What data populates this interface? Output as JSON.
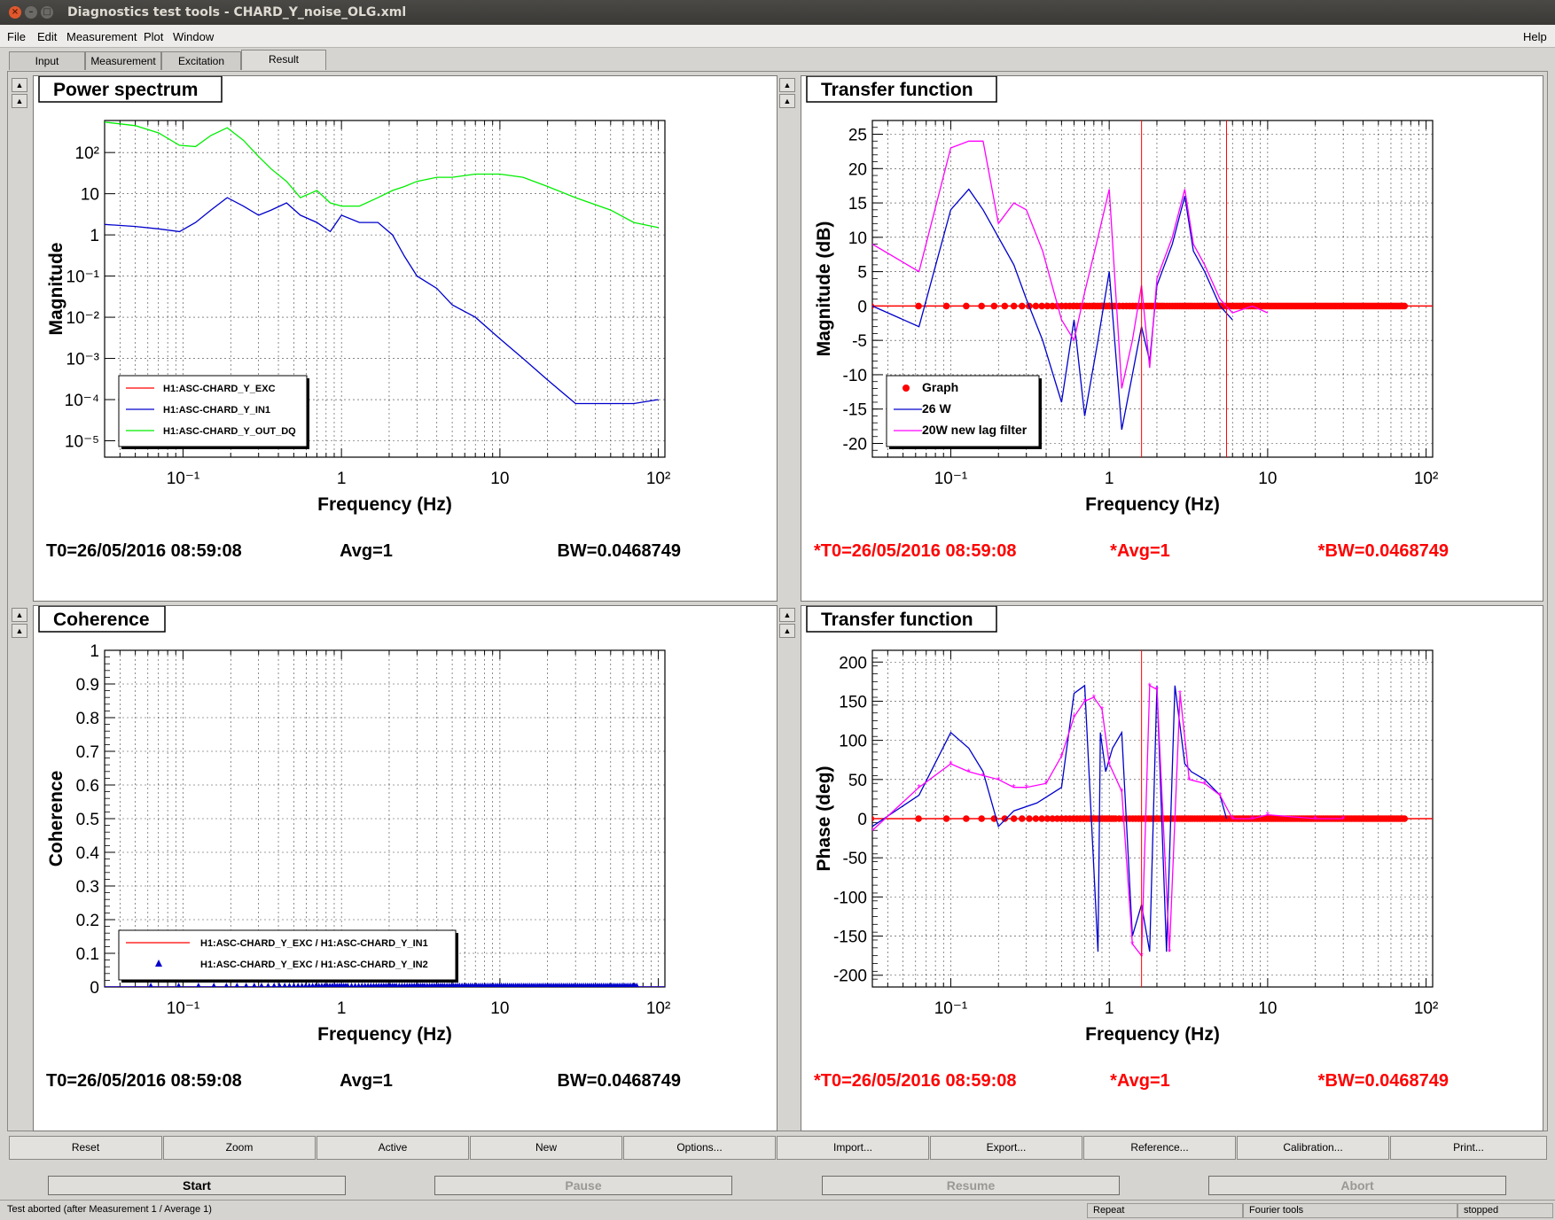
{
  "window": {
    "title": "Diagnostics test tools - CHARD_Y_noise_OLG.xml"
  },
  "menu": {
    "file": "File",
    "edit": "Edit",
    "measurement": "Measurement",
    "plot": "Plot",
    "window": "Window",
    "help": "Help"
  },
  "tabs": {
    "input": "Input",
    "measurement": "Measurement",
    "excitation": "Excitation",
    "result": "Result"
  },
  "buttons": {
    "reset": "Reset",
    "zoom": "Zoom",
    "active": "Active",
    "new": "New",
    "options": "Options...",
    "import": "Import...",
    "export": "Export...",
    "reference": "Reference...",
    "calibration": "Calibration...",
    "print": "Print..."
  },
  "controls": {
    "start": "Start",
    "pause": "Pause",
    "resume": "Resume",
    "abort": "Abort"
  },
  "status": {
    "message": "Test aborted (after Measurement 1 / Average 1)",
    "repeat": "Repeat",
    "fourier": "Fourier tools",
    "state": "stopped"
  },
  "colors": {
    "red": "#ff0000",
    "blue": "#0000cc",
    "green": "#00ee00",
    "magenta": "#ff00ff"
  },
  "chart_data": [
    {
      "type": "line",
      "title": "Power spectrum",
      "xlabel": "Frequency (Hz)",
      "ylabel": "Magnitude",
      "x_scale": "log",
      "y_scale": "log",
      "xlim": [
        0.032,
        110
      ],
      "ylim": [
        4e-06,
        600
      ],
      "x_ticks": [
        "10⁻¹",
        "1",
        "10",
        "10²"
      ],
      "y_ticks": [
        "10⁻⁵",
        "10⁻⁴",
        "10⁻³",
        "10⁻²",
        "10⁻¹",
        "1",
        "10",
        "10²"
      ],
      "footer": {
        "t0": "T0=26/05/2016 08:59:08",
        "avg": "Avg=1",
        "bw": "BW=0.0468749"
      },
      "legend": [
        "H1:ASC-CHARD_Y_EXC",
        "H1:ASC-CHARD_Y_IN1",
        "H1:ASC-CHARD_Y_OUT_DQ"
      ],
      "legend_position": "bottom-left",
      "series": [
        {
          "name": "H1:ASC-CHARD_Y_IN1",
          "x": [
            0.032,
            0.05,
            0.07,
            0.095,
            0.12,
            0.15,
            0.19,
            0.24,
            0.3,
            0.36,
            0.45,
            0.55,
            0.7,
            0.85,
            1.0,
            1.3,
            1.7,
            2.1,
            2.5,
            3,
            4,
            5,
            7,
            10,
            14,
            20,
            30,
            50,
            70,
            100
          ],
          "y": [
            1.8,
            1.6,
            1.4,
            1.2,
            2.0,
            4,
            8,
            5,
            3,
            4,
            6,
            3,
            2,
            1.2,
            3,
            2,
            2,
            1,
            0.3,
            0.1,
            0.05,
            0.02,
            0.01,
            0.003,
            0.001,
            0.0003,
            8e-05,
            8e-05,
            8e-05,
            0.0001
          ]
        },
        {
          "name": "H1:ASC-CHARD_Y_OUT_DQ",
          "x": [
            0.032,
            0.05,
            0.07,
            0.095,
            0.12,
            0.15,
            0.19,
            0.24,
            0.3,
            0.36,
            0.45,
            0.55,
            0.7,
            0.85,
            1.0,
            1.3,
            1.7,
            2.1,
            2.5,
            3,
            4,
            5,
            7,
            10,
            14,
            20,
            30,
            50,
            70,
            100
          ],
          "y": [
            550,
            450,
            300,
            150,
            140,
            260,
            400,
            200,
            80,
            40,
            20,
            8,
            12,
            6,
            5,
            5,
            8,
            12,
            15,
            20,
            25,
            25,
            30,
            30,
            25,
            15,
            8,
            4,
            2,
            1.5
          ]
        }
      ]
    },
    {
      "type": "line",
      "title": "Transfer function",
      "xlabel": "Frequency (Hz)",
      "ylabel": "Magnitude (dB)",
      "x_scale": "log",
      "xlim": [
        0.032,
        110
      ],
      "ylim": [
        -22,
        27
      ],
      "x_ticks": [
        "10⁻¹",
        "1",
        "10",
        "10²"
      ],
      "y_ticks": [
        "-20",
        "-15",
        "-10",
        "-5",
        "0",
        "5",
        "10",
        "15",
        "20",
        "25"
      ],
      "footer": {
        "t0": "*T0=26/05/2016 08:59:08",
        "avg": "*Avg=1",
        "bw": "*BW=0.0468749"
      },
      "legend": [
        "Graph",
        "26 W",
        "20W new lag filter"
      ],
      "legend_position": "bottom-left",
      "series": [
        {
          "name": "Graph",
          "x": [
            0.032,
            110
          ],
          "y": [
            0,
            0
          ]
        },
        {
          "name": "26 W",
          "x": [
            0.032,
            0.063,
            0.1,
            0.13,
            0.16,
            0.2,
            0.25,
            0.3,
            0.38,
            0.5,
            0.6,
            0.7,
            0.85,
            1.0,
            1.2,
            1.4,
            1.6,
            1.8,
            2.0,
            2.5,
            3.0,
            3.4,
            4.0,
            5.0,
            6.0
          ],
          "y": [
            0,
            -3,
            14,
            17,
            14,
            10,
            6,
            1,
            -5,
            -14,
            -2,
            -16,
            -5,
            5,
            -18,
            -10,
            -3,
            -8,
            3,
            9,
            16,
            8,
            5,
            0,
            -2
          ]
        },
        {
          "name": "20W new lag filter",
          "x": [
            0.032,
            0.063,
            0.1,
            0.13,
            0.16,
            0.2,
            0.25,
            0.3,
            0.38,
            0.5,
            0.6,
            0.7,
            0.85,
            1.0,
            1.2,
            1.4,
            1.6,
            1.8,
            2.0,
            2.5,
            3.0,
            3.4,
            4.0,
            5.0,
            6.0,
            8.0,
            10.0
          ],
          "y": [
            9,
            5,
            23,
            24,
            24,
            12,
            15,
            14,
            8,
            -2,
            -5,
            2,
            10,
            17,
            -12,
            -5,
            3,
            -9,
            4,
            10,
            17,
            9,
            6,
            1,
            -1,
            0,
            -1
          ]
        }
      ]
    },
    {
      "type": "line",
      "title": "Coherence",
      "xlabel": "Frequency (Hz)",
      "ylabel": "Coherence",
      "x_scale": "log",
      "xlim": [
        0.032,
        110
      ],
      "ylim": [
        0,
        1
      ],
      "x_ticks": [
        "10⁻¹",
        "1",
        "10",
        "10²"
      ],
      "y_ticks": [
        "0",
        "0.1",
        "0.2",
        "0.3",
        "0.4",
        "0.5",
        "0.6",
        "0.7",
        "0.8",
        "0.9",
        "1"
      ],
      "footer": {
        "t0": "T0=26/05/2016 08:59:08",
        "avg": "Avg=1",
        "bw": "BW=0.0468749"
      },
      "legend": [
        "H1:ASC-CHARD_Y_EXC / H1:ASC-CHARD_Y_IN1",
        "H1:ASC-CHARD_Y_EXC / H1:ASC-CHARD_Y_IN2"
      ],
      "legend_position": "bottom-left",
      "series": [
        {
          "name": "H1:ASC-CHARD_Y_EXC / H1:ASC-CHARD_Y_IN1",
          "x": [
            0.032,
            110
          ],
          "y": [
            0,
            0
          ]
        },
        {
          "name": "H1:ASC-CHARD_Y_EXC / H1:ASC-CHARD_Y_IN2",
          "x": [
            0.032,
            110
          ],
          "y": [
            0,
            0
          ]
        }
      ]
    },
    {
      "type": "line",
      "title": "Transfer function",
      "xlabel": "Frequency (Hz)",
      "ylabel": "Phase (deg)",
      "x_scale": "log",
      "xlim": [
        0.032,
        110
      ],
      "ylim": [
        -215,
        215
      ],
      "x_ticks": [
        "10⁻¹",
        "1",
        "10",
        "10²"
      ],
      "y_ticks": [
        "-200",
        "-150",
        "-100",
        "-50",
        "0",
        "50",
        "100",
        "150",
        "200"
      ],
      "footer": {
        "t0": "*T0=26/05/2016 08:59:08",
        "avg": "*Avg=1",
        "bw": "*BW=0.0468749"
      },
      "series": [
        {
          "name": "Graph",
          "x": [
            0.032,
            110
          ],
          "y": [
            0,
            0
          ]
        },
        {
          "name": "26 W",
          "x": [
            0.032,
            0.063,
            0.1,
            0.13,
            0.16,
            0.2,
            0.25,
            0.35,
            0.5,
            0.6,
            0.7,
            0.85,
            0.88,
            0.95,
            1.05,
            1.2,
            1.4,
            1.6,
            1.8,
            2.0,
            2.3,
            2.6,
            3.0,
            3.3,
            4.0,
            5.0,
            5.5
          ],
          "y": [
            -10,
            30,
            110,
            90,
            60,
            -10,
            10,
            20,
            40,
            160,
            170,
            -170,
            110,
            60,
            90,
            110,
            -150,
            -110,
            -170,
            170,
            -170,
            170,
            70,
            60,
            50,
            30,
            0
          ]
        },
        {
          "name": "20W new lag filter",
          "x": [
            0.032,
            0.063,
            0.1,
            0.13,
            0.16,
            0.2,
            0.25,
            0.3,
            0.4,
            0.5,
            0.6,
            0.7,
            0.8,
            0.9,
            1.0,
            1.2,
            1.4,
            1.6,
            1.8,
            2.0,
            2.4,
            2.8,
            3.2,
            4.0,
            5.0,
            6.0,
            8.0,
            10.0,
            20.0,
            30.0
          ],
          "y": [
            -15,
            40,
            70,
            60,
            55,
            50,
            40,
            40,
            45,
            80,
            130,
            150,
            155,
            140,
            70,
            35,
            -160,
            -175,
            170,
            165,
            -170,
            160,
            50,
            45,
            30,
            0,
            0,
            5,
            0,
            0
          ]
        }
      ]
    }
  ]
}
